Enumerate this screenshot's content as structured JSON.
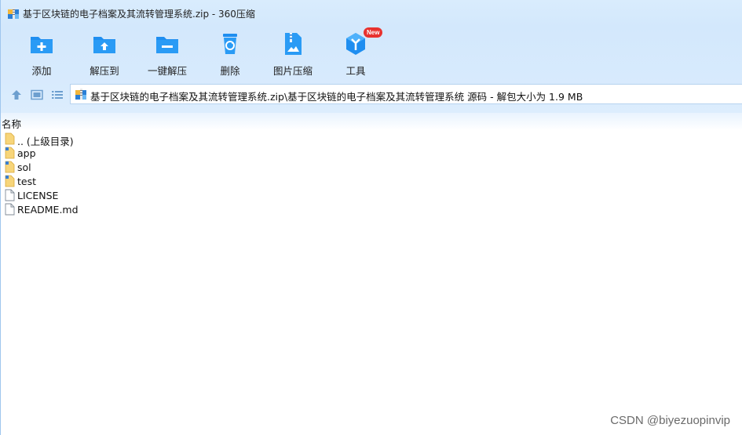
{
  "window": {
    "title": "基于区块链的电子档案及其流转管理系统.zip - 360压缩"
  },
  "toolbar": {
    "buttons": [
      {
        "label": "添加",
        "icon": "add-folder-icon"
      },
      {
        "label": "解压到",
        "icon": "extract-to-icon"
      },
      {
        "label": "一键解压",
        "icon": "one-click-extract-icon"
      },
      {
        "label": "删除",
        "icon": "recycle-bin-icon"
      },
      {
        "label": "图片压缩",
        "icon": "image-compress-icon"
      },
      {
        "label": "工具",
        "icon": "tools-icon",
        "badge": "New"
      }
    ]
  },
  "navigation": {
    "up_icon": "arrow-up-icon",
    "view_thumbnail_icon": "thumbnail-view-icon",
    "view_list_icon": "list-view-icon",
    "address_path": "基于区块链的电子档案及其流转管理系统.zip\\基于区块链的电子档案及其流转管理系统 源码 - 解包大小为 1.9 MB"
  },
  "filelist": {
    "column_name": "名称",
    "items": [
      {
        "name": ".. (上级目录)",
        "type": "folder"
      },
      {
        "name": "app",
        "type": "folder"
      },
      {
        "name": "sol",
        "type": "folder"
      },
      {
        "name": "test",
        "type": "folder"
      },
      {
        "name": "LICENSE",
        "type": "file"
      },
      {
        "name": "README.md",
        "type": "file"
      }
    ]
  },
  "watermark": "CSDN @biyezuopinvip",
  "colors": {
    "accent": "#1f8ef0",
    "title_bg": "#d6eafc",
    "folder": "#f7d57a",
    "badge": "#e8322e"
  }
}
